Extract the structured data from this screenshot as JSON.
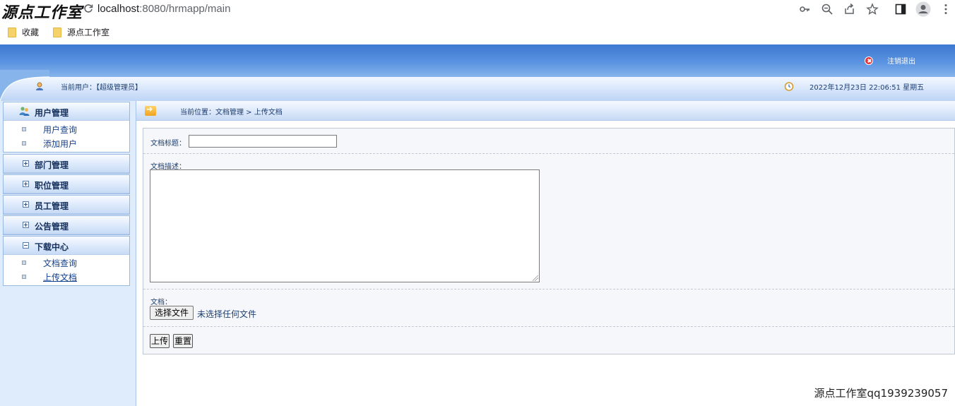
{
  "browser": {
    "watermark": "源点工作室",
    "url_host": "localhost",
    "url_path": ":8080/hrmapp/main",
    "bookmarks": [
      "收藏",
      "源点工作室"
    ]
  },
  "header": {
    "logout": "注销退出",
    "current_user": "当前用户：【超级管理员】",
    "datetime": "2022年12月23日 22:06:51 星期五"
  },
  "sidebar": {
    "groups": [
      {
        "title": "用户管理",
        "items": [
          "用户查询",
          "添加用户"
        ]
      },
      {
        "title": "部门管理"
      },
      {
        "title": "职位管理"
      },
      {
        "title": "员工管理"
      },
      {
        "title": "公告管理"
      },
      {
        "title": "下载中心",
        "items": [
          "文档查询",
          "上传文档"
        ]
      }
    ]
  },
  "breadcrumb": "当前位置：文档管理 > 上传文档",
  "form": {
    "title_label": "文档标题：",
    "title_value": "",
    "desc_label": "文档描述：",
    "desc_value": "",
    "file_label": "文档：",
    "file_button": "选择文件",
    "file_status": "未选择任何文件",
    "submit": "上传",
    "reset": "重置"
  },
  "footer_watermark": "源点工作室qq1939239057",
  "colors": {
    "header_blue": "#3d78d1",
    "sidebar_bg": "#dfecfc",
    "text_blue": "#1d3f73"
  }
}
